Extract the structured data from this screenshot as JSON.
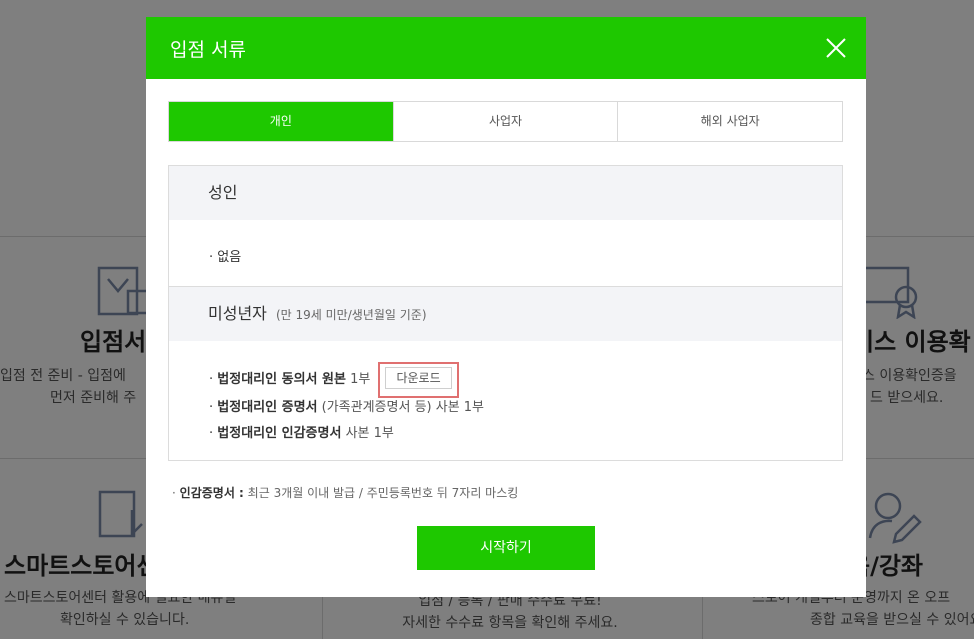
{
  "background": {
    "cards": [
      {
        "title": "입점서",
        "desc1": "입점 전 준비 - 입점에",
        "desc2": "먼저 준비해 주"
      },
      {
        "title": "비스 이용확",
        "desc1": "스 이용확인증을",
        "desc2": "드 받으세요."
      },
      {
        "title": "스마트스토어센",
        "desc1": "스마트스토어센터 활용에 필요한 매뉴얼",
        "desc2": "확인하실 수 있습니다."
      },
      {
        "title": "",
        "desc1": "입점 / 등록 / 판매 수수료 무료!",
        "desc2": "자세한 수수료 항목을 확인해 주세요."
      },
      {
        "title": "육/강좌",
        "desc1": "스토어 개설부터 운영까지 온 오프",
        "desc2": "종합 교육을 받으실 수 있어요"
      }
    ]
  },
  "modal": {
    "title": "입점 서류",
    "close_icon": "close-icon",
    "tabs": [
      {
        "label": "개인",
        "active": true
      },
      {
        "label": "사업자",
        "active": false
      },
      {
        "label": "해외 사업자",
        "active": false
      }
    ],
    "adult": {
      "heading": "성인",
      "items": [
        "· 없음"
      ]
    },
    "minor": {
      "heading": "미성년자",
      "subheading": "(만 19세 미만/생년월일 기준)",
      "items": [
        {
          "bullet": "·",
          "bold": "법정대리인 동의서 원본",
          "rest": "1부",
          "button": "다운로드"
        },
        {
          "bullet": "·",
          "bold": "법정대리인 증명서",
          "rest": "(가족관계증명서 등) 사본 1부"
        },
        {
          "bullet": "·",
          "bold": "법정대리인 인감증명서",
          "rest": "사본 1부"
        }
      ]
    },
    "note": {
      "bullet": "·",
      "bold": "인감증명서 :",
      "text": "최근 3개월 이내 발급 / 주민등록번호 뒤 7자리 마스킹"
    },
    "start_button": "시작하기",
    "accent_color": "#1ec800"
  }
}
